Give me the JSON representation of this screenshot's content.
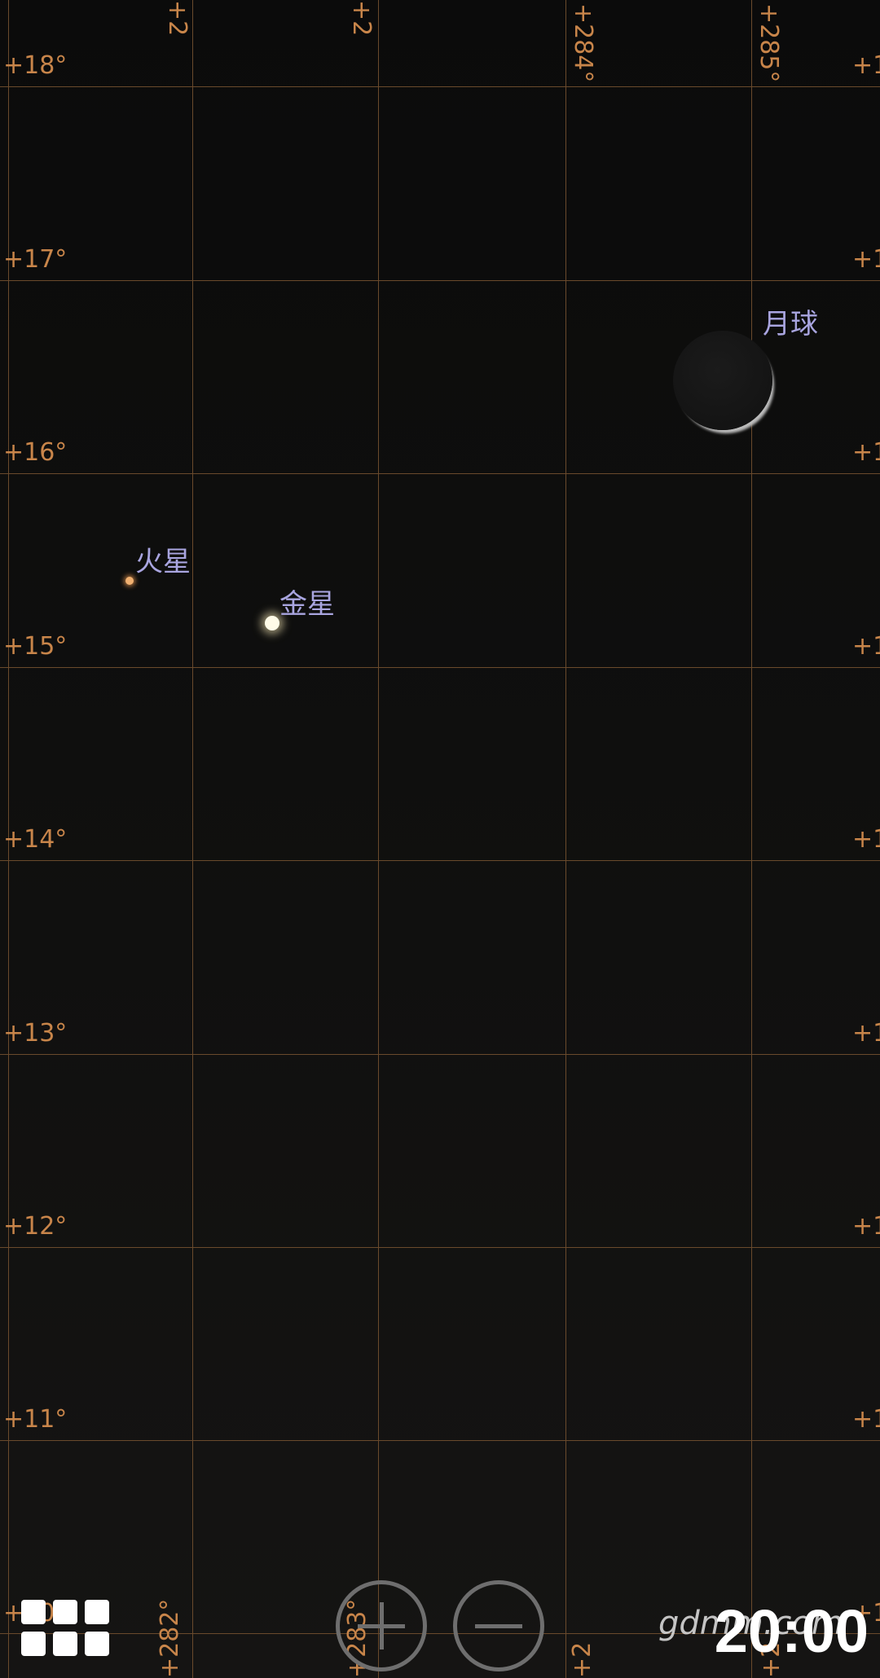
{
  "grid": {
    "dec_labels_left": [
      "+18°",
      "+17°",
      "+16°",
      "+15°",
      "+14°",
      "+13°",
      "+12°",
      "+11°",
      "+10"
    ],
    "dec_labels_right": [
      "+1",
      "+1",
      "+1",
      "+1",
      "+1",
      "+1",
      "+1",
      "+1",
      "+1"
    ],
    "ra_labels_top": [
      "+2",
      "+2",
      "+284°",
      "+285°"
    ],
    "ra_labels_bottom": [
      "+282°",
      "+283°",
      "+2",
      "+2"
    ]
  },
  "objects": {
    "moon_label": "月球",
    "mars_label": "火星",
    "venus_label": "金星"
  },
  "controls": {
    "menu_icon": "grid-menu-icon",
    "zoom_in_icon": "zoom-in-icon",
    "zoom_out_icon": "zoom-out-icon"
  },
  "status": {
    "time": "20:00",
    "watermark": "gdmm.com"
  },
  "colors": {
    "grid_line": "#6a4a2c",
    "grid_label": "#c8854a",
    "object_label": "#a9a5e0",
    "background": "#0b0b0b"
  }
}
